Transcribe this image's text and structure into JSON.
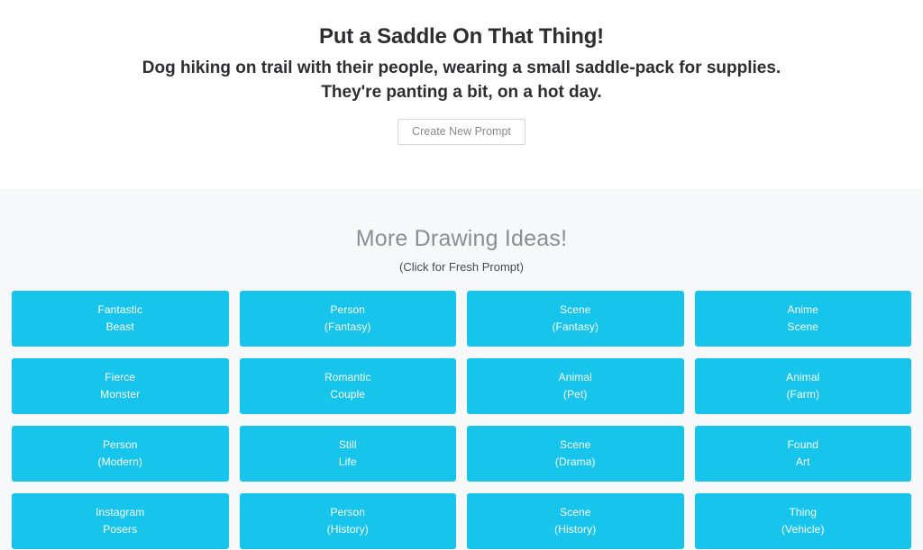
{
  "prompt": {
    "title": "Put a Saddle On That Thing!",
    "description_line_1": "Dog hiking on trail with their people, wearing a small saddle-pack for supplies.",
    "description_line_2": "They're panting a bit, on a hot day.",
    "new_prompt_label": "Create New Prompt"
  },
  "ideas": {
    "heading": "More Drawing Ideas!",
    "subheading": "(Click for Fresh Prompt)",
    "tile_color": "#16c4ec",
    "tiles": [
      {
        "line1": "Fantastic",
        "line2": "Beast"
      },
      {
        "line1": "Person",
        "line2": "(Fantasy)"
      },
      {
        "line1": "Scene",
        "line2": "(Fantasy)"
      },
      {
        "line1": "Anime",
        "line2": "Scene"
      },
      {
        "line1": "Fierce",
        "line2": "Monster"
      },
      {
        "line1": "Romantic",
        "line2": "Couple"
      },
      {
        "line1": "Animal",
        "line2": "(Pet)"
      },
      {
        "line1": "Animal",
        "line2": "(Farm)"
      },
      {
        "line1": "Person",
        "line2": "(Modern)"
      },
      {
        "line1": "Still",
        "line2": "Life"
      },
      {
        "line1": "Scene",
        "line2": "(Drama)"
      },
      {
        "line1": "Found",
        "line2": "Art"
      },
      {
        "line1": "Instagram",
        "line2": "Posers"
      },
      {
        "line1": "Person",
        "line2": "(History)"
      },
      {
        "line1": "Scene",
        "line2": "(History)"
      },
      {
        "line1": "Thing",
        "line2": "(Vehicle)"
      }
    ]
  }
}
